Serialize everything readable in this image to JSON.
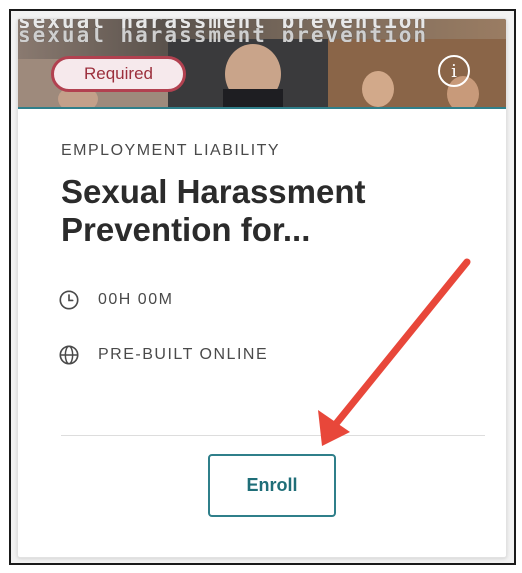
{
  "course_card": {
    "banner_text": "sexual harassment prevention",
    "required_badge": "Required",
    "info_icon": "info-icon",
    "category": "EMPLOYMENT LIABILITY",
    "title": "Sexual Harassment Prevention for...",
    "duration": {
      "icon": "clock-icon",
      "text": "00H 00M"
    },
    "format": {
      "icon": "globe-icon",
      "text": "PRE-BUILT ONLINE"
    },
    "enroll_label": "Enroll"
  },
  "annotation": {
    "type": "arrow",
    "color": "#e8473a"
  },
  "colors": {
    "accent": "#2f7f8a",
    "required_border": "#b24150",
    "required_bg": "#f6e9ec"
  }
}
